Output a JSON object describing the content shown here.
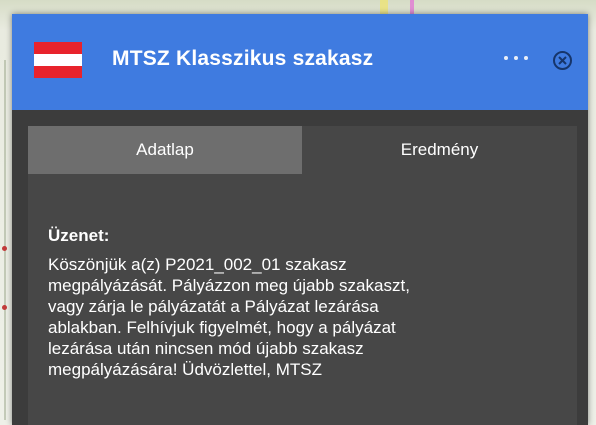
{
  "popup": {
    "title": "MTSZ Klasszikus szakasz",
    "flag_colors": [
      "#e8232c",
      "#ffffff",
      "#e8232c"
    ],
    "header_color": "#3f7be0",
    "more_icon": "more-horizontal-icon",
    "close_icon": "close-circle-icon"
  },
  "tabs": [
    {
      "label": "Adatlap",
      "active": true
    },
    {
      "label": "Eredmény",
      "active": false
    }
  ],
  "message": {
    "label": "Üzenet:",
    "lines": [
      "Köszönjük a(z) P2021_002_01 szakasz",
      "megpályázását. Pályázzon meg újabb szakaszt,",
      "vagy zárja le pályázatát a Pályázat lezárása",
      "ablakban. Felhívjuk figyelmét, hogy a pályázat",
      "lezárása után nincsen mód újabb szakasz",
      "megpályázására! Üdvözlettel, MTSZ"
    ]
  }
}
